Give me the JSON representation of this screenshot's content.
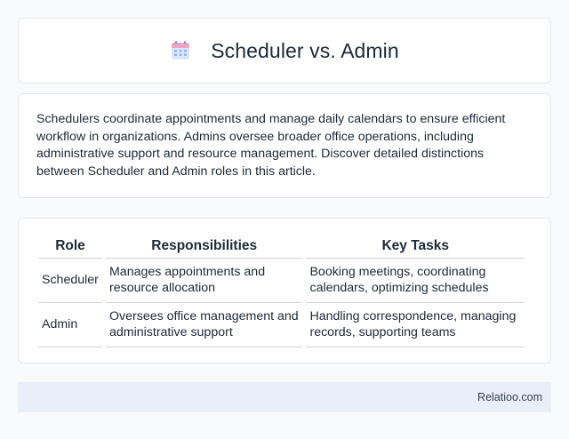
{
  "header": {
    "icon": "calendar-icon",
    "title": "Scheduler vs. Admin"
  },
  "description": "Schedulers coordinate appointments and manage daily calendars to ensure efficient workflow in organizations. Admins oversee broader office operations, including administrative support and resource management. Discover detailed distinctions between Scheduler and Admin roles in this article.",
  "table": {
    "headers": [
      "Role",
      "Responsibilities",
      "Key Tasks"
    ],
    "rows": [
      [
        "Scheduler",
        "Manages appointments and resource allocation",
        "Booking meetings, coordinating calendars, optimizing schedules"
      ],
      [
        "Admin",
        "Oversees office management and administrative support",
        "Handling correspondence, managing records, supporting teams"
      ]
    ]
  },
  "footer": {
    "brand": "Relatioo.com"
  },
  "colors": {
    "icon_blue": "#93b4f0",
    "icon_pink": "#f0a3c4",
    "footer_bg": "#e9eef8"
  }
}
